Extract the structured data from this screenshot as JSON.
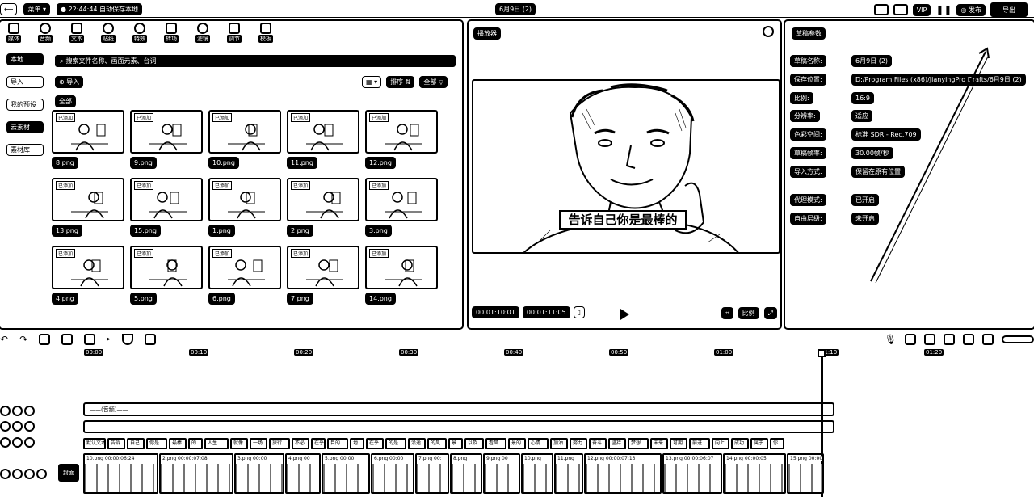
{
  "topbar": {
    "menu_label": "菜单",
    "autosave": "22:44:44 自动保存本地",
    "project_title": "6月9日 (2)",
    "vip": "VIP",
    "publish": "发布",
    "export": "导出"
  },
  "media": {
    "tabs": [
      {
        "label": "媒体",
        "icon": "media-icon"
      },
      {
        "label": "音频",
        "icon": "audio-icon"
      },
      {
        "label": "文本",
        "icon": "text-icon"
      },
      {
        "label": "贴纸",
        "icon": "sticker-icon"
      },
      {
        "label": "特效",
        "icon": "effects-icon"
      },
      {
        "label": "转场",
        "icon": "transition-icon"
      },
      {
        "label": "滤镜",
        "icon": "filter-icon"
      },
      {
        "label": "调节",
        "icon": "adjust-icon"
      },
      {
        "label": "模板",
        "icon": "template-icon"
      }
    ],
    "side": [
      "本地",
      "导入",
      "我的预设",
      "云素材",
      "素材库"
    ],
    "search_placeholder": "搜索文件名称、画面元素、台词",
    "import_label": "导入",
    "sort_label": "排序",
    "filter_label": "全部",
    "all_label": "全部",
    "added_badge": "已添加",
    "items": [
      "8.png",
      "9.png",
      "10.png",
      "11.png",
      "12.png",
      "13.png",
      "15.png",
      "1.png",
      "2.png",
      "3.png",
      "4.png",
      "5.png",
      "6.png",
      "7.png",
      "14.png"
    ]
  },
  "player": {
    "title": "播放器",
    "subtitle": "告诉自己你是最棒的",
    "current_time": "00:01:10:01",
    "total_time": "00:01:11:05",
    "ratio_label": "比例"
  },
  "props": {
    "title": "草稿参数",
    "rows": [
      {
        "k": "草稿名称:",
        "v": "6月9日 (2)"
      },
      {
        "k": "保存位置:",
        "v": "D:/Program Files (x86)/JianyingPro Drafts/6月9日 (2)"
      },
      {
        "k": "比例:",
        "v": "16:9"
      },
      {
        "k": "分辨率:",
        "v": "适应"
      },
      {
        "k": "色彩空间:",
        "v": "标准 SDR - Rec.709"
      },
      {
        "k": "草稿帧率:",
        "v": "30.00帧/秒"
      },
      {
        "k": "导入方式:",
        "v": "保留在原有位置"
      },
      {
        "k": "代理模式:",
        "v": "已开启"
      },
      {
        "k": "自由层级:",
        "v": "未开启"
      }
    ]
  },
  "timeline": {
    "ticks": [
      "00:00",
      "00:10",
      "00:20",
      "00:30",
      "00:40",
      "00:50",
      "01:00",
      "01:10",
      "01:20"
    ],
    "cover_label": "封面",
    "audio_label": "——(音频)——",
    "text_clips": [
      "默认文本",
      "告诉",
      "自己",
      "你是",
      "最棒",
      "的",
      "人生",
      "就像",
      "一场",
      "旅行",
      "不必",
      "在乎",
      "目的",
      "地",
      "在乎",
      "的是",
      "沿途",
      "的风",
      "景",
      "以及",
      "看风",
      "景的",
      "心情",
      "加油",
      "努力",
      "奋斗",
      "坚持",
      "梦想",
      "未来",
      "可期",
      "前进",
      "向上",
      "成功",
      "属于",
      "你"
    ],
    "video_clips": [
      {
        "label": "10.png  00:00:06:24"
      },
      {
        "label": "2.png  00:00:07:08"
      },
      {
        "label": "3.png  00:00"
      },
      {
        "label": "4.png  00"
      },
      {
        "label": "5.png  00:00"
      },
      {
        "label": "6.png  00:00"
      },
      {
        "label": "7.png  00:"
      },
      {
        "label": "8.png"
      },
      {
        "label": "9.png  00"
      },
      {
        "label": "10.png"
      },
      {
        "label": "11.png"
      },
      {
        "label": "12.png  00:00:07:13"
      },
      {
        "label": "13.png  00:00:06:07"
      },
      {
        "label": "14.png  00:00:05"
      },
      {
        "label": "15.png  00:00"
      }
    ]
  }
}
